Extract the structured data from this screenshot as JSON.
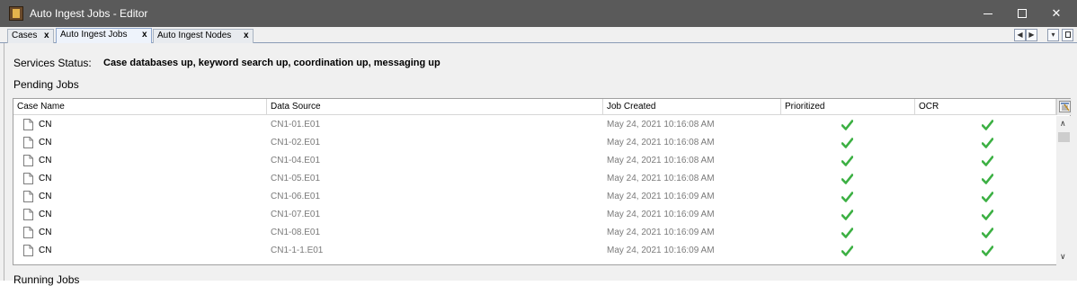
{
  "window": {
    "title": "Auto Ingest Jobs - Editor",
    "controls": {
      "minimize": "minimize",
      "maximize": "maximize",
      "close": "✕"
    }
  },
  "tabs": [
    {
      "label": "Cases",
      "close": "x"
    },
    {
      "label": "Auto Ingest Jobs",
      "close": "x",
      "active": true
    },
    {
      "label": "Auto Ingest Nodes",
      "close": "x"
    }
  ],
  "tab_controls": {
    "scroll_left": "◀",
    "scroll_right": "▶",
    "dropdown": "▾"
  },
  "services": {
    "label": "Services Status:",
    "value": "Case databases up, keyword search up, coordination up, messaging up"
  },
  "pending": {
    "title": "Pending Jobs",
    "columns": [
      "Case Name",
      "Data Source",
      "Job Created",
      "Prioritized",
      "OCR"
    ],
    "rows": [
      {
        "case": "CN",
        "source": "CN1-01.E01",
        "created": "May 24, 2021 10:16:08 AM",
        "prioritized": true,
        "ocr": true
      },
      {
        "case": "CN",
        "source": "CN1-02.E01",
        "created": "May 24, 2021 10:16:08 AM",
        "prioritized": true,
        "ocr": true
      },
      {
        "case": "CN",
        "source": "CN1-04.E01",
        "created": "May 24, 2021 10:16:08 AM",
        "prioritized": true,
        "ocr": true
      },
      {
        "case": "CN",
        "source": "CN1-05.E01",
        "created": "May 24, 2021 10:16:08 AM",
        "prioritized": true,
        "ocr": true
      },
      {
        "case": "CN",
        "source": "CN1-06.E01",
        "created": "May 24, 2021 10:16:09 AM",
        "prioritized": true,
        "ocr": true
      },
      {
        "case": "CN",
        "source": "CN1-07.E01",
        "created": "May 24, 2021 10:16:09 AM",
        "prioritized": true,
        "ocr": true
      },
      {
        "case": "CN",
        "source": "CN1-08.E01",
        "created": "May 24, 2021 10:16:09 AM",
        "prioritized": true,
        "ocr": true
      },
      {
        "case": "CN",
        "source": "CN1-1-1.E01",
        "created": "May 24, 2021 10:16:09 AM",
        "prioritized": true,
        "ocr": true
      }
    ]
  },
  "running": {
    "title": "Running Jobs"
  },
  "colors": {
    "titlebar": "#5a5a5a",
    "check": "#3cb043",
    "accent_border": "#8fa7cc"
  },
  "icons": {
    "row_icon": "document-icon",
    "check_icon": "checkmark-icon",
    "column_picker": "column-picker-icon"
  }
}
